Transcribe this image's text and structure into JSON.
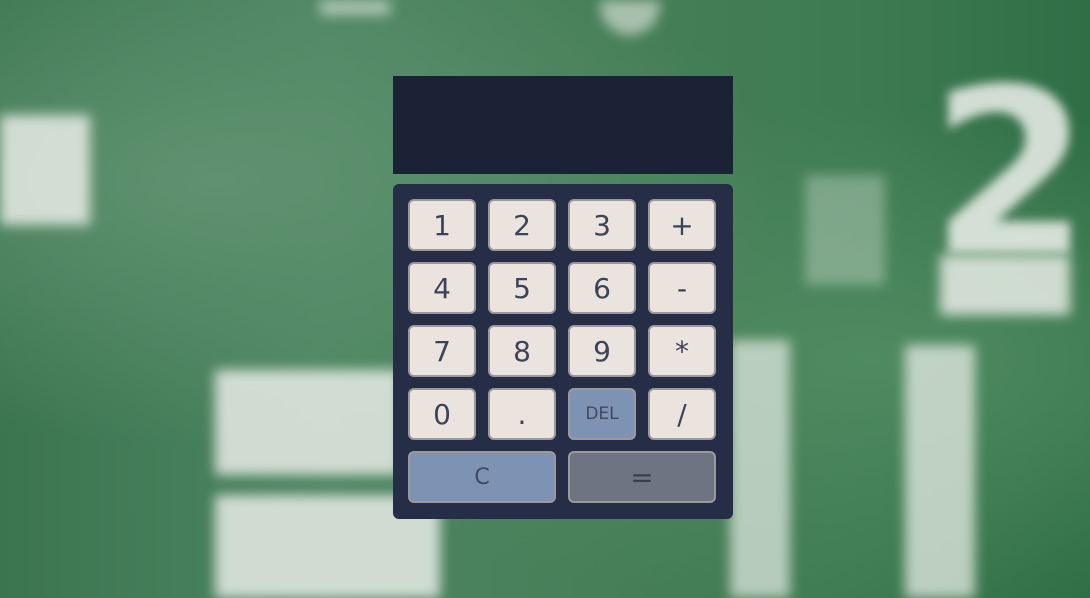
{
  "display": {
    "value": ""
  },
  "keys": {
    "k1": "1",
    "k2": "2",
    "k3": "3",
    "plus": "+",
    "k4": "4",
    "k5": "5",
    "k6": "6",
    "minus": "-",
    "k7": "7",
    "k8": "8",
    "k9": "9",
    "multiply": "*",
    "k0": "0",
    "dot": ".",
    "del": "DEL",
    "divide": "/",
    "clear": "C",
    "equals": "="
  },
  "colors": {
    "display_bg": "#1b2235",
    "keypad_bg": "#252d47",
    "key_bg": "#ebe3dd",
    "del_clear_bg": "#7e93b3",
    "equals_bg": "#6e7482",
    "background": "#3f7a52"
  }
}
